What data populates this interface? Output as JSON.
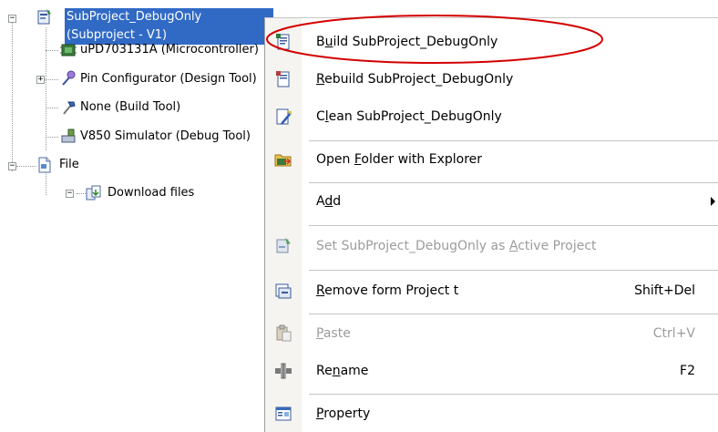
{
  "tree": {
    "items": [
      {
        "label": "SubProject_DebugOnly (Subproject - V1)",
        "icon": "project-icon",
        "expander": "−",
        "selected": true
      },
      {
        "label": "uPD703131A (Microcontroller)",
        "icon": "microcontroller-icon"
      },
      {
        "label": "Pin Configurator (Design Tool)",
        "icon": "pin-configurator-icon",
        "expander": "+"
      },
      {
        "label": "None (Build Tool)",
        "icon": "build-tool-icon"
      },
      {
        "label": "V850 Simulator (Debug Tool)",
        "icon": "simulator-icon"
      },
      {
        "label": "File",
        "icon": "file-icon",
        "expander": "−"
      },
      {
        "label": "Download files",
        "icon": "download-files-icon",
        "expander": "−"
      }
    ]
  },
  "menu": {
    "items": [
      {
        "label": "Build SubProject_DebugOnly",
        "icon": "build-icon",
        "accel": "u"
      },
      {
        "label": "Rebuild SubProject_DebugOnly",
        "icon": "rebuild-icon",
        "accel": "R"
      },
      {
        "label": "Clean SubProject_DebugOnly",
        "icon": "clean-icon",
        "accel": "l"
      },
      {
        "label": "Open Folder with Explorer",
        "icon": "open-folder-icon",
        "accel": "F"
      },
      {
        "label": "Add",
        "has_submenu": true,
        "accel": "d"
      },
      {
        "label": "Set SubProject_DebugOnly as Active Project",
        "icon": "set-active-icon",
        "disabled": true,
        "accel": "A"
      },
      {
        "label": "Remove form Project t",
        "icon": "remove-icon",
        "shortcut": "Shift+Del",
        "accel": "R"
      },
      {
        "label": "Paste",
        "icon": "paste-icon",
        "shortcut": "Ctrl+V",
        "disabled": true,
        "accel": "P"
      },
      {
        "label": "Rename",
        "icon": "rename-icon",
        "shortcut": "F2",
        "accel": "n"
      },
      {
        "label": "Property",
        "icon": "property-icon",
        "accel": "P"
      }
    ]
  },
  "colors": {
    "selection": "#316ac5",
    "annotation_ellipse": "#d40000",
    "disabled_text": "#9c9c9c"
  }
}
